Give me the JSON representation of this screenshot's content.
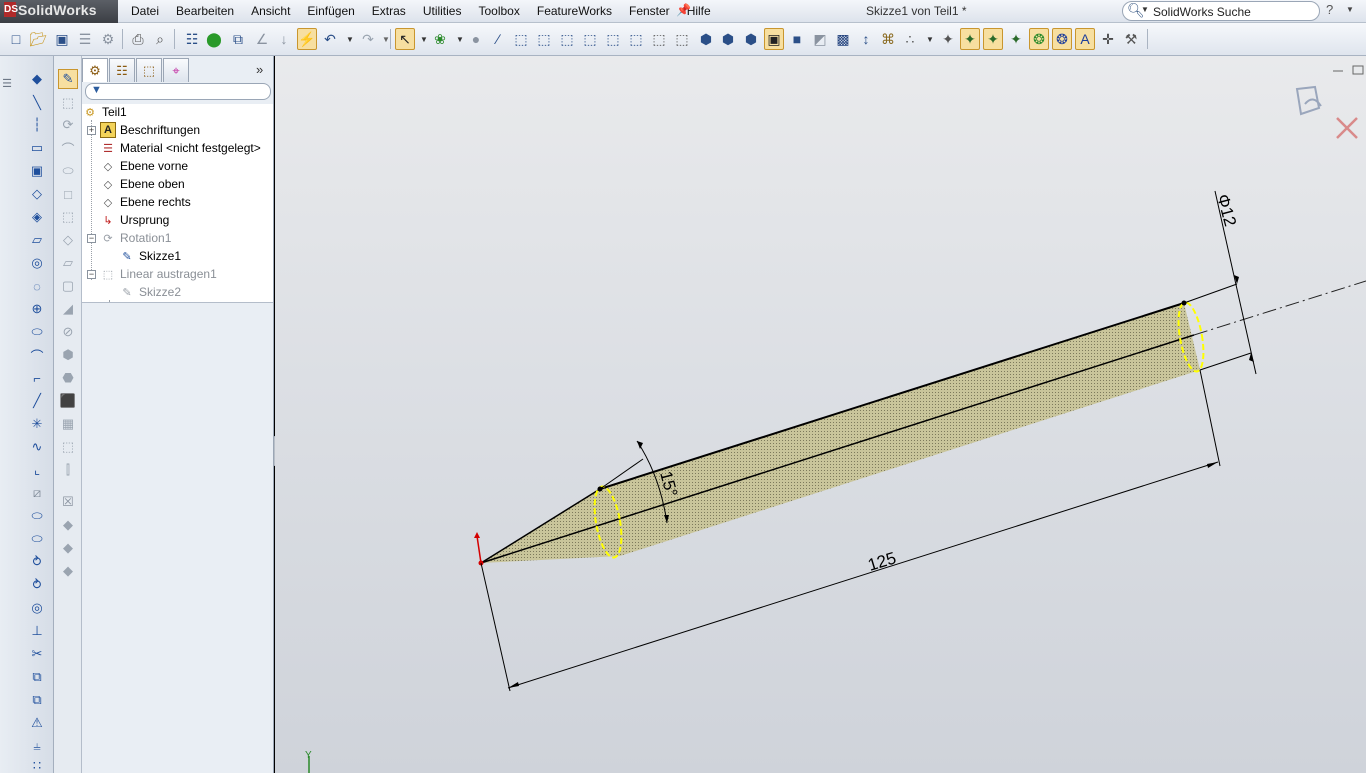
{
  "app": {
    "logo_text": "SolidWorks",
    "logo_mark": "DS"
  },
  "menu": {
    "items": [
      "Datei",
      "Bearbeiten",
      "Ansicht",
      "Einfügen",
      "Extras",
      "Utilities",
      "Toolbox",
      "FeatureWorks",
      "Fenster",
      "Hilfe"
    ]
  },
  "window": {
    "title": "Skizze1 von Teil1 *"
  },
  "search": {
    "placeholder": "SolidWorks Suche",
    "help": "?"
  },
  "toolbar": {
    "icons": [
      "new-file",
      "open-file",
      "save",
      "print-setup",
      "options",
      "print",
      "print-preview",
      "properties",
      "rebuild",
      "assembly",
      "sketch",
      "smart-dimension",
      "rebuild-traffic",
      "undo",
      "redo",
      "select",
      "selection-filter",
      "appearance",
      "view-orientation",
      "isometric",
      "front",
      "back",
      "top",
      "bottom",
      "left",
      "right",
      "trimetric",
      "dimetric",
      "wireframe",
      "hidden-lines",
      "shaded-edges",
      "shaded",
      "section-view",
      "display-manager",
      "zoom",
      "rotate",
      "pan",
      "view-settings",
      "view-origins",
      "view-axes",
      "view-planes",
      "view-sketches",
      "view-dimensions",
      "curvature"
    ]
  },
  "feature_manager": {
    "root": "Teil1",
    "items": [
      {
        "label": "Beschriftungen",
        "dim": false
      },
      {
        "label": "Material <nicht festgelegt>",
        "dim": false
      },
      {
        "label": "Ebene vorne",
        "dim": false
      },
      {
        "label": "Ebene oben",
        "dim": false
      },
      {
        "label": "Ebene rechts",
        "dim": false
      },
      {
        "label": "Ursprung",
        "dim": false
      },
      {
        "label": "Rotation1",
        "dim": true
      },
      {
        "label": "Skizze1",
        "dim": false
      },
      {
        "label": "Linear austragen1",
        "dim": true
      },
      {
        "label": "Skizze2",
        "dim": true
      }
    ]
  },
  "graphics": {
    "dimensions": {
      "diameter": "Φ12",
      "angle": "15°",
      "length": "125"
    },
    "colors": {
      "body": "#c7c39a",
      "edge": "#000000",
      "highlight": "#ffff00",
      "origin": "#d40000"
    }
  }
}
